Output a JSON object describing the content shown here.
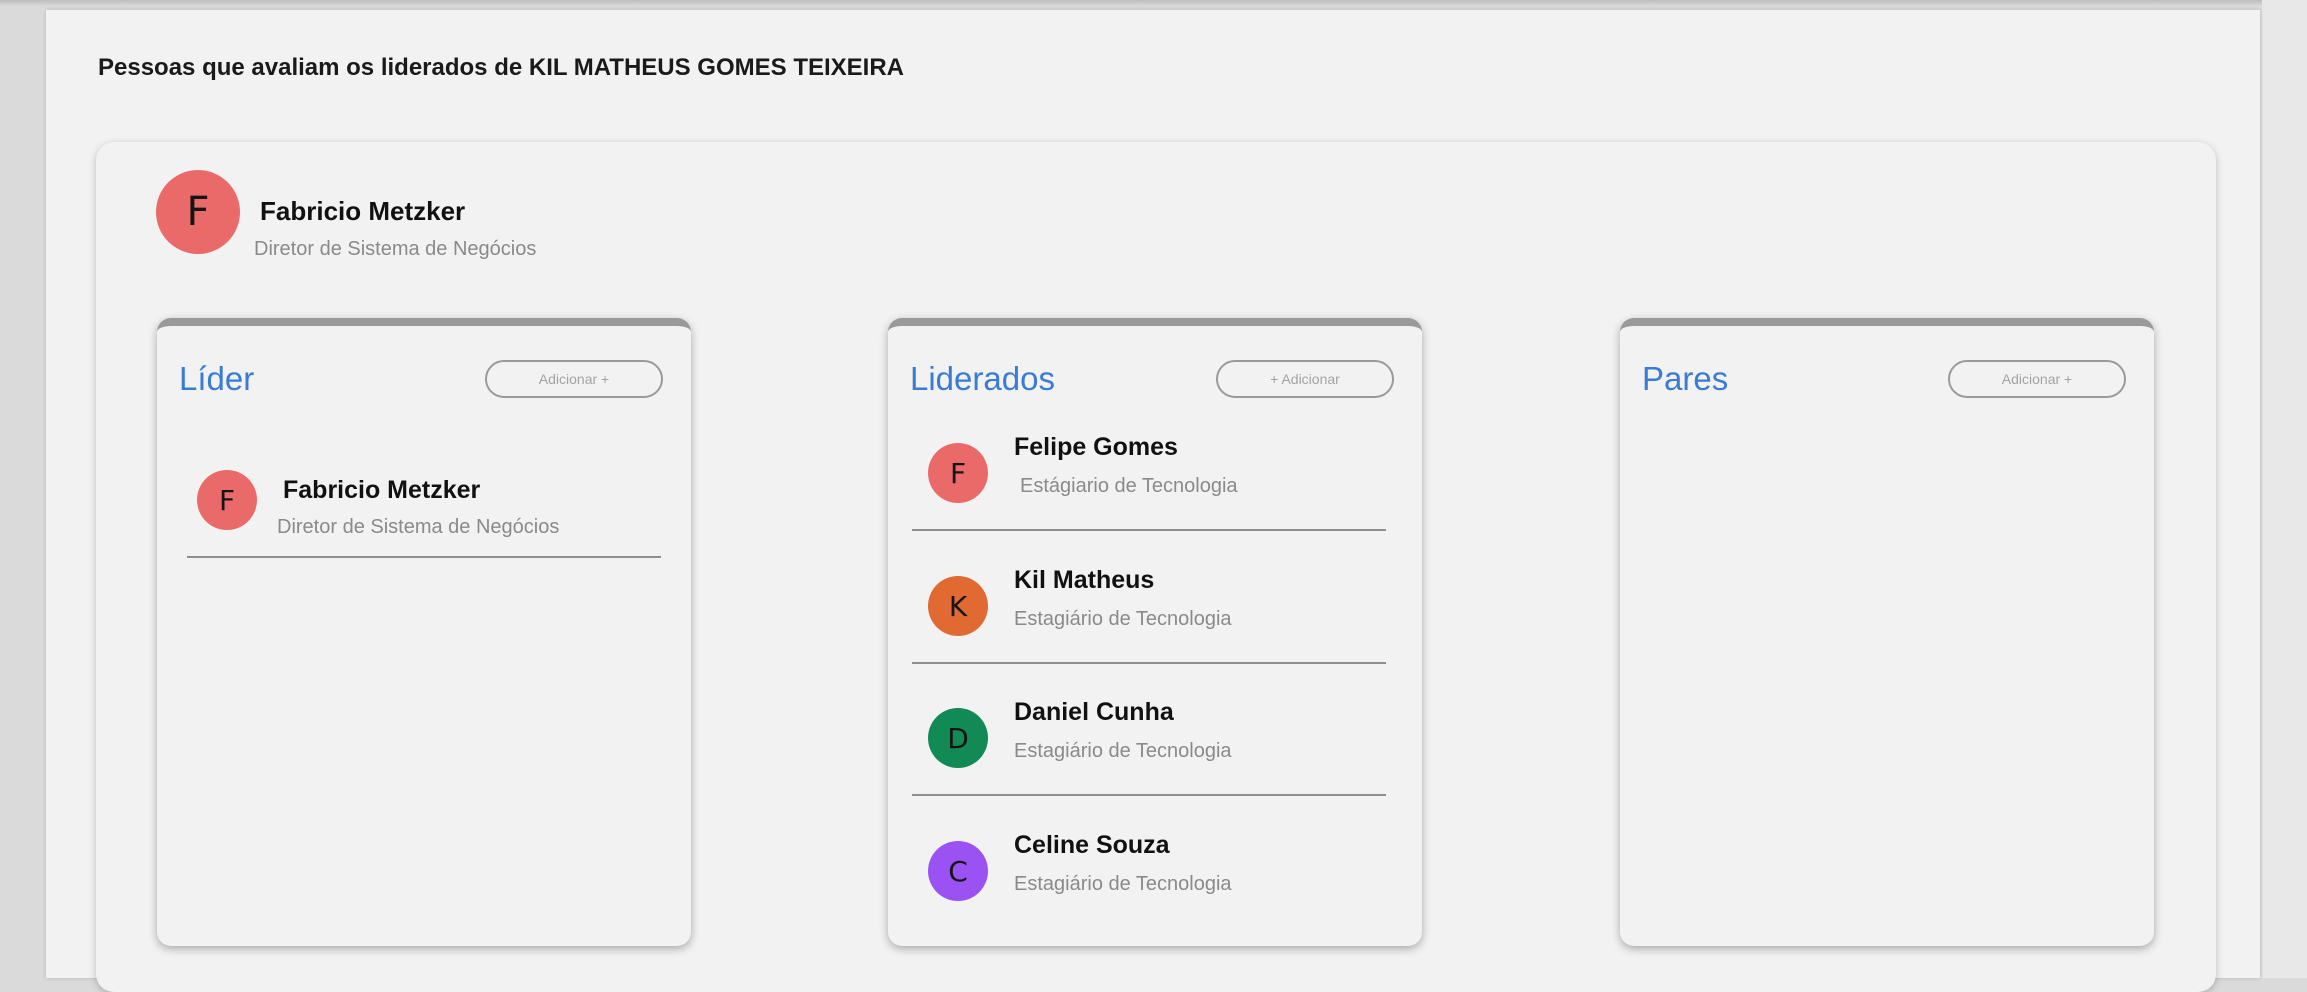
{
  "page": {
    "title": "Pessoas que avaliam os liderados de KIL MATHEUS GOMES TEIXEIRA"
  },
  "head": {
    "initial": "F",
    "name": "Fabricio Metzker",
    "role": "Diretor de Sistema de Negócios",
    "color": "#ea6a6a"
  },
  "panels": {
    "lider": {
      "title": "Líder",
      "add_label": "Adicionar +",
      "items": [
        {
          "initial": "F",
          "name": "Fabricio Metzker",
          "role": "Diretor de Sistema de Negócios",
          "color": "#ea6a6a"
        }
      ]
    },
    "liderados": {
      "title": "Liderados",
      "add_label": "+ Adicionar",
      "items": [
        {
          "initial": "F",
          "name": "Felipe Gomes",
          "role": "Estágiario de Tecnologia",
          "color": "#ea6a6a"
        },
        {
          "initial": "K",
          "name": "Kil Matheus",
          "role": "Estagiário de Tecnologia",
          "color": "#e06a32"
        },
        {
          "initial": "D",
          "name": "Daniel Cunha",
          "role": "Estagiário de Tecnologia",
          "color": "#128a55"
        },
        {
          "initial": "C",
          "name": "Celine Souza",
          "role": "Estagiário de Tecnologia",
          "color": "#9b52f2"
        }
      ]
    },
    "pares": {
      "title": "Pares",
      "add_label": "Adicionar +",
      "items": []
    }
  },
  "colors": {
    "accent": "#3a7bd5",
    "background": "#f2f2f2"
  }
}
